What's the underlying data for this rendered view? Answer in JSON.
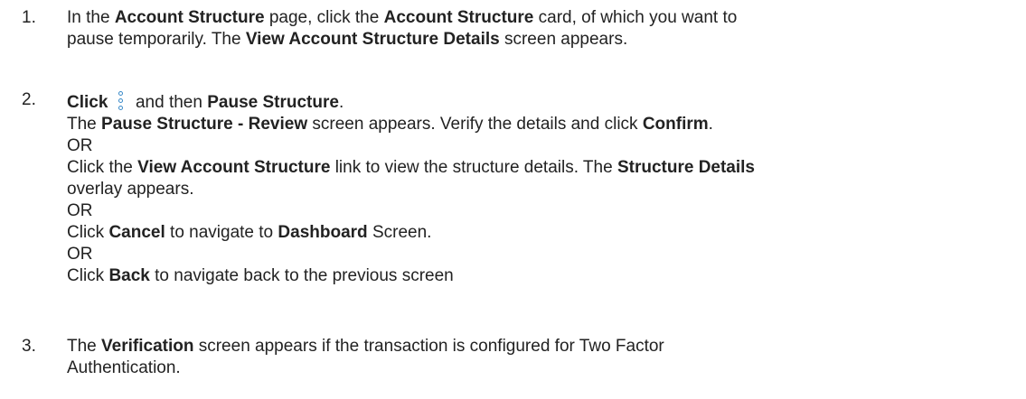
{
  "steps": [
    {
      "number": "1.",
      "segments": [
        {
          "text": " In the ",
          "bold": false
        },
        {
          "text": "Account Structure",
          "bold": true
        },
        {
          "text": " page, click the ",
          "bold": false
        },
        {
          "text": "Account Structure",
          "bold": true
        },
        {
          "text": " card, of which you want to",
          "bold": false
        },
        {
          "text": "pause temporarily. The ",
          "bold": false,
          "newline": true
        },
        {
          "text": "View Account",
          "bold": true
        },
        {
          "text": " ",
          "bold": false
        },
        {
          "text": "Structure Details",
          "bold": true
        },
        {
          "text": " screen appears.",
          "bold": false
        }
      ]
    },
    {
      "number": "2.",
      "line1": {
        "click": "Click",
        "then": " and then ",
        "pause": "Pause Structure",
        "period": "."
      },
      "icon": "kebab-menu-icon",
      "rest": [
        [
          {
            "text": "The ",
            "bold": false
          },
          {
            "text": "Pause Structure - Review",
            "bold": true
          },
          {
            "text": " screen appears. Verify the details and click ",
            "bold": false
          },
          {
            "text": "Confirm",
            "bold": true
          },
          {
            "text": ".",
            "bold": false
          }
        ],
        [
          {
            "text": "OR",
            "bold": false
          }
        ],
        [
          {
            "text": "Click the ",
            "bold": false
          },
          {
            "text": "View Account Structure",
            "bold": true
          },
          {
            "text": " link to view the structure details. The ",
            "bold": false
          },
          {
            "text": "Structure Details",
            "bold": true
          }
        ],
        [
          {
            "text": "overlay appears.",
            "bold": false
          }
        ],
        [
          {
            "text": "OR",
            "bold": false
          }
        ],
        [
          {
            "text": "Click ",
            "bold": false
          },
          {
            "text": "Cancel",
            "bold": true
          },
          {
            "text": " to navigate to ",
            "bold": false
          },
          {
            "text": "Dashboard",
            "bold": true
          },
          {
            "text": " Screen.",
            "bold": false
          }
        ],
        [
          {
            "text": "OR",
            "bold": false
          }
        ],
        [
          {
            "text": "Click ",
            "bold": false
          },
          {
            "text": "Back",
            "bold": true
          },
          {
            "text": " to navigate back to the previous screen",
            "bold": false
          }
        ]
      ]
    },
    {
      "number": "3.",
      "lines": [
        [
          {
            "text": "The ",
            "bold": false
          },
          {
            "text": "Verification",
            "bold": true
          },
          {
            "text": " screen appears if the transaction is configured for Two Factor",
            "bold": false
          }
        ],
        [
          {
            "text": "Authentication.",
            "bold": false
          }
        ]
      ]
    }
  ],
  "colors": {
    "text": "#222222",
    "icon": "#3a8ac8"
  }
}
